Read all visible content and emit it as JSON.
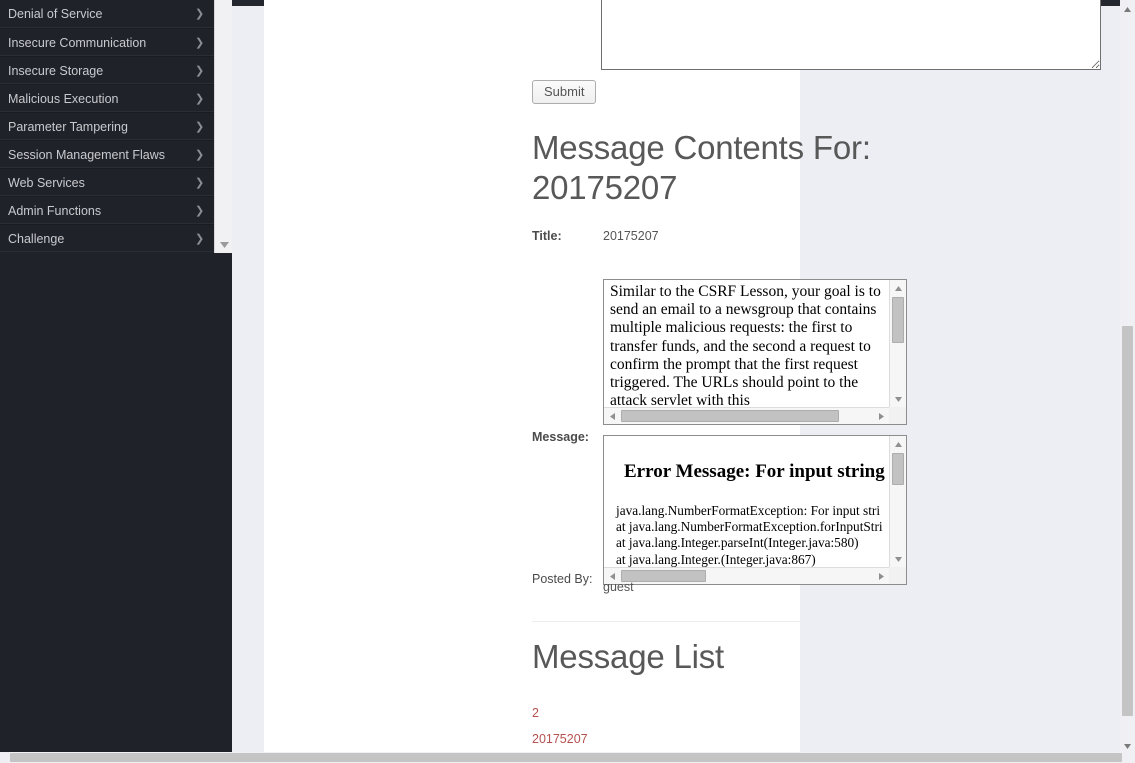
{
  "sidebar": {
    "items": [
      {
        "label": "Denial of Service",
        "icon": "chevron-right-icon"
      },
      {
        "label": "Insecure Communication",
        "icon": "chevron-right-icon"
      },
      {
        "label": "Insecure Storage",
        "icon": "chevron-right-icon"
      },
      {
        "label": "Malicious Execution",
        "icon": "chevron-right-icon"
      },
      {
        "label": "Parameter Tampering",
        "icon": "chevron-right-icon"
      },
      {
        "label": "Session Management Flaws",
        "icon": "chevron-right-icon"
      },
      {
        "label": "Web Services",
        "icon": "chevron-right-icon"
      },
      {
        "label": "Admin Functions",
        "icon": "chevron-right-icon"
      },
      {
        "label": "Challenge",
        "icon": "chevron-right-icon"
      }
    ],
    "scroll_down_icon": "scroll-down-arrow-icon"
  },
  "form": {
    "message_textarea_value": "",
    "message_textarea_placeholder": "",
    "submit_label": "Submit"
  },
  "message_contents": {
    "heading": "Message Contents For: 20175207",
    "title_label": "Title:",
    "title_value": "20175207",
    "message_label": "Message:",
    "message_body": "Similar to the CSRF Lesson, your goal is to send an email to a newsgroup that contains multiple malicious requests: the first to transfer funds, and the second a request to confirm the prompt that the first request triggered. The URLs should point to the attack servlet with this",
    "error_heading": "Error Message: For input string",
    "error_trace": "java.lang.NumberFormatException: For input stri\nat java.lang.NumberFormatException.forInputStri\nat java.lang.Integer.parseInt(Integer.java:580)\nat java.lang.Integer.(Integer.java:867)",
    "posted_by_label": "Posted By:",
    "posted_by_value": "guest"
  },
  "message_list": {
    "heading": "Message List",
    "links": [
      {
        "label": "2"
      },
      {
        "label": "20175207"
      }
    ]
  },
  "colors": {
    "sidebar_bg": "#20222a",
    "link": "#b5514f",
    "heading": "#585858"
  }
}
